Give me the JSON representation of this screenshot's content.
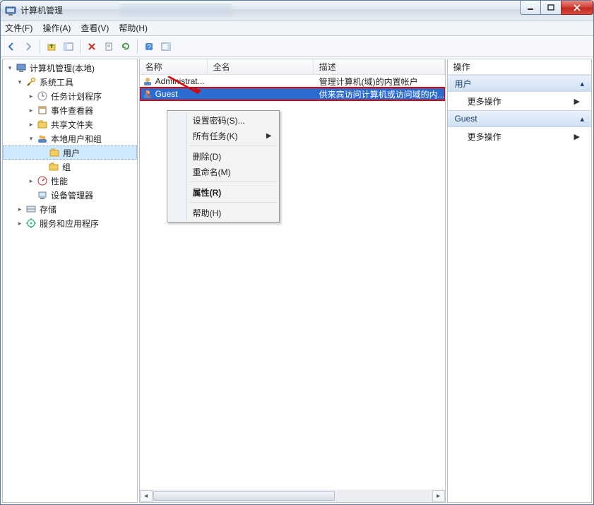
{
  "window": {
    "title": "计算机管理"
  },
  "menu": {
    "file": "文件(F)",
    "action": "操作(A)",
    "view": "查看(V)",
    "help": "帮助(H)"
  },
  "tree": {
    "root": "计算机管理(本地)",
    "system_tools": "系统工具",
    "task_scheduler": "任务计划程序",
    "event_viewer": "事件查看器",
    "shared_folders": "共享文件夹",
    "local_users": "本地用户和组",
    "users": "用户",
    "groups": "组",
    "performance": "性能",
    "device_manager": "设备管理器",
    "storage": "存储",
    "services": "服务和应用程序"
  },
  "list": {
    "col_name": "名称",
    "col_fullname": "全名",
    "col_desc": "描述",
    "rows": [
      {
        "name": "Administrat...",
        "fullname": "",
        "desc": "管理计算机(域)的内置帐户"
      },
      {
        "name": "Guest",
        "fullname": "",
        "desc": "供来宾访问计算机或访问域的内..."
      }
    ]
  },
  "context_menu": {
    "set_password": "设置密码(S)...",
    "all_tasks": "所有任务(K)",
    "delete": "删除(D)",
    "rename": "重命名(M)",
    "properties": "属性(R)",
    "help": "帮助(H)"
  },
  "actions": {
    "title": "操作",
    "section1": "用户",
    "more1": "更多操作",
    "section2": "Guest",
    "more2": "更多操作"
  }
}
